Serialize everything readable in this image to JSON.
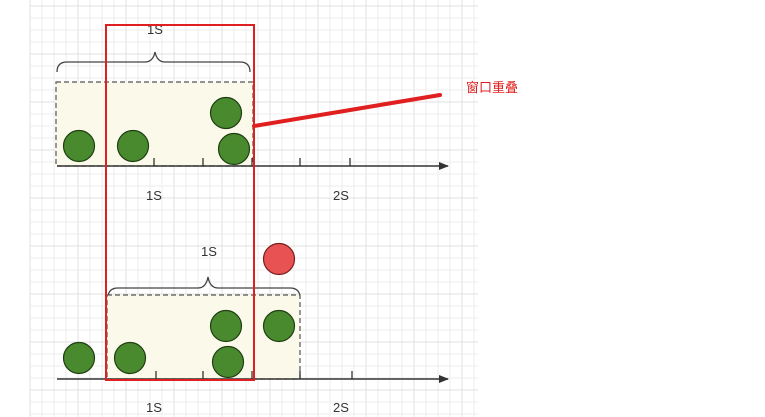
{
  "colors": {
    "grid": "#ececec",
    "grid_major": "#e0e0e0",
    "axis": "#333333",
    "window_fill": "#fbf9ea",
    "window_border": "#555555",
    "ball_green": "#4a8a2e",
    "ball_stroke": "#1f3f12",
    "ball_red": "#e85252",
    "highlight": "#e02020"
  },
  "top_row": {
    "window_label": "1S",
    "axis_ticks": [
      "1S",
      "2S"
    ]
  },
  "bottom_row": {
    "window_label": "1S",
    "axis_ticks": [
      "1S",
      "2S"
    ]
  },
  "callout": {
    "text": "窗口重叠"
  }
}
